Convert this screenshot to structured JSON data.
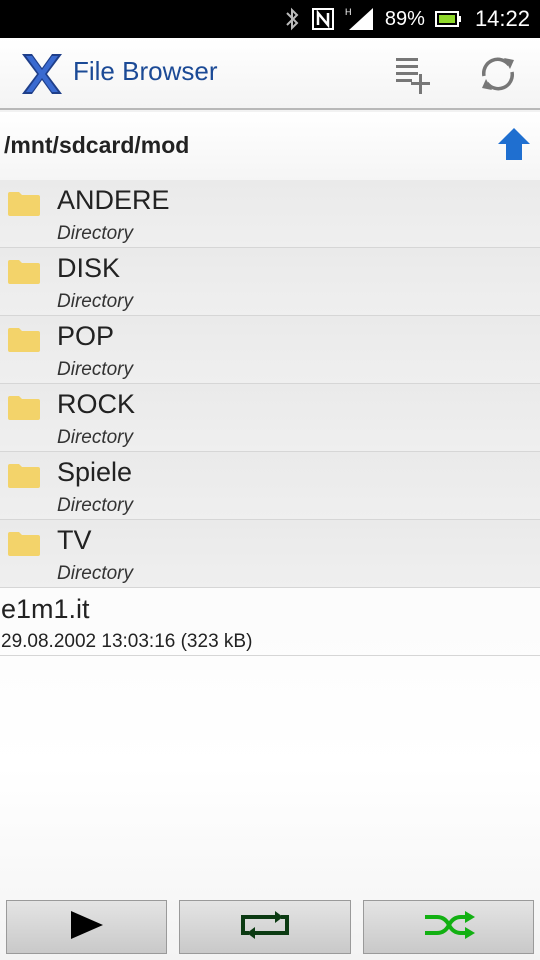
{
  "status_bar": {
    "battery": "89%",
    "time": "14:22",
    "icons": [
      "bluetooth-icon",
      "nfc-icon",
      "signal-hplus-icon",
      "battery-icon"
    ]
  },
  "app": {
    "title": "File Browser",
    "actions": [
      "add-to-playlist-icon",
      "refresh-icon"
    ]
  },
  "path": {
    "current": "/mnt/sdcard/mod"
  },
  "directories": [
    {
      "name": "ANDERE",
      "type": "Directory"
    },
    {
      "name": "DISK",
      "type": "Directory"
    },
    {
      "name": "POP",
      "type": "Directory"
    },
    {
      "name": "ROCK",
      "type": "Directory"
    },
    {
      "name": "Spiele",
      "type": "Directory"
    },
    {
      "name": "TV",
      "type": "Directory"
    }
  ],
  "files": [
    {
      "name": "e1m1.it",
      "meta": "29.08.2002 13:03:16 (323 kB)"
    }
  ],
  "player": {
    "buttons": [
      "play-icon",
      "repeat-icon",
      "shuffle-icon"
    ],
    "colors": {
      "repeat": "#0b3a12",
      "shuffle": "#12b012"
    }
  },
  "colors": {
    "title": "#1b4a96",
    "folder": "#f3d36a",
    "up_arrow": "#1f6fd0"
  }
}
